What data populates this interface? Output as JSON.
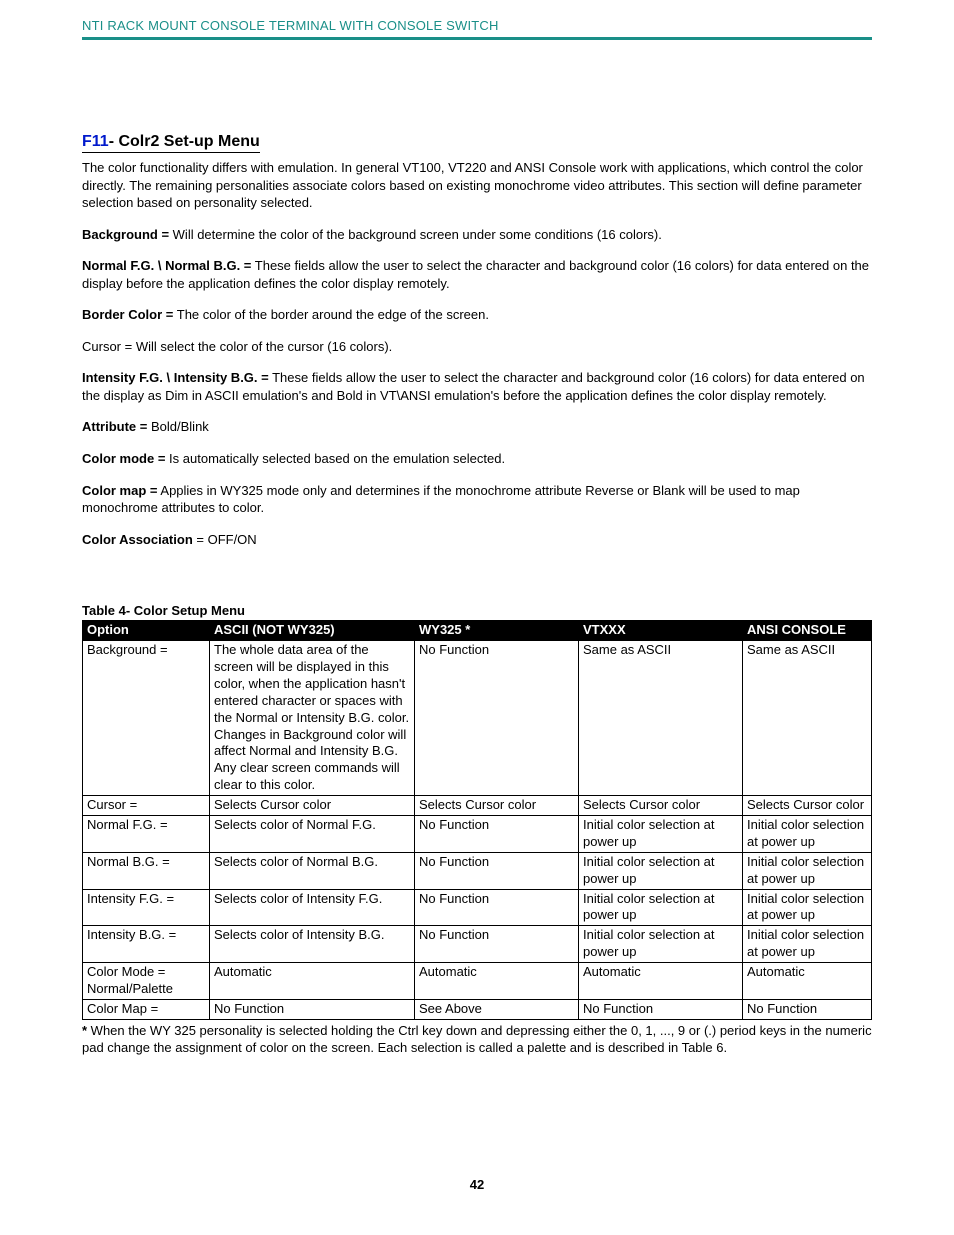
{
  "header": "NTI RACK MOUNT CONSOLE TERMINAL WITH CONSOLE SWITCH",
  "title_link": "F11",
  "title_rest": "- Colr2 Set-up Menu",
  "p_intro": "The color functionality differs with emulation.  In general VT100, VT220 and ANSI Console work with applications, which control the color directly. The remaining personalities associate colors based on existing monochrome video attributes. This section will define parameter selection based on personality selected.",
  "background_label": "Background =",
  "background_text": " Will determine the color of the background screen under some conditions (16 colors).",
  "normalfgbg_label": "Normal F.G. \\ Normal B.G. =",
  "normalfgbg_text": " These fields allow the user to select the character and background color (16 colors) for data entered on the display before the application defines the color display remotely.",
  "border_label": "Border Color =",
  "border_text": " The color of the border around the edge of the screen.",
  "cursor_line": "Cursor = Will select the color of the cursor (16 colors).",
  "intensity_label": "Intensity F.G. \\ Intensity B.G. =",
  "intensity_text": " These fields allow the user to select the character and background color (16 colors) for data entered on the display as Dim in ASCII emulation's and Bold in VT\\ANSI emulation's before the application defines the color display remotely.",
  "attribute_label": "Attribute =",
  "attribute_text": " Bold/Blink",
  "colormode_label": "Color mode =",
  "colormode_text": " Is automatically selected based on the emulation selected.",
  "colormap_label": "Color map =",
  "colormap_text": " Applies in WY325 mode only and determines if the monochrome attribute Reverse or Blank will be used to map monochrome attributes to color.",
  "assoc_label": "Color Association",
  "assoc_text": " = OFF/ON",
  "table_caption": "Table 4- Color Setup Menu",
  "table": {
    "headers": [
      "Option",
      "ASCII (NOT WY325)",
      "WY325 *",
      "VTXXX",
      "ANSI CONSOLE"
    ],
    "rows": [
      {
        "cells": [
          "Background =",
          "The whole data area of the screen will be displayed in this color, when the application hasn't entered character or spaces with the Normal or Intensity B.G. color. Changes in Background color will affect Normal and Intensity B.G. Any clear screen commands will clear to this color.",
          "No Function",
          "Same as ASCII",
          "Same as ASCII"
        ]
      },
      {
        "cells": [
          "Cursor =",
          "Selects Cursor color",
          "Selects Cursor color",
          "Selects Cursor color",
          "Selects Cursor color"
        ]
      },
      {
        "cells": [
          "Normal F.G. =",
          "Selects color of Normal F.G.",
          "No Function",
          "Initial color selection at power up",
          "Initial color selection at power up"
        ]
      },
      {
        "cells": [
          "Normal B.G. =",
          "Selects color of Normal B.G.",
          "No Function",
          "Initial color selection at power up",
          "Initial color selection at power up"
        ]
      },
      {
        "cells": [
          "Intensity F.G. =",
          "Selects color of Intensity F.G.",
          "No Function",
          "Initial color selection at power up",
          "Initial color selection at power up"
        ]
      },
      {
        "cells": [
          "Intensity B.G. =",
          "Selects color of Intensity B.G.",
          "No Function",
          "Initial color selection at power up",
          "Initial color selection at power up"
        ]
      },
      {
        "cells": [
          "Color Mode = Normal/Palette",
          "Automatic",
          "Automatic",
          "Automatic",
          "Automatic"
        ]
      },
      {
        "cells": [
          "Color Map =",
          "No Function",
          "See Above",
          "No Function",
          "No Function"
        ]
      }
    ]
  },
  "footnote_star": "*",
  "footnote_text": " When the WY 325 personality is selected holding the Ctrl key down and depressing either the 0, 1, ..., 9 or (.) period keys in the numeric pad change the assignment of color on the screen. Each selection is called a palette and is described in Table 6.",
  "page_number": "42"
}
